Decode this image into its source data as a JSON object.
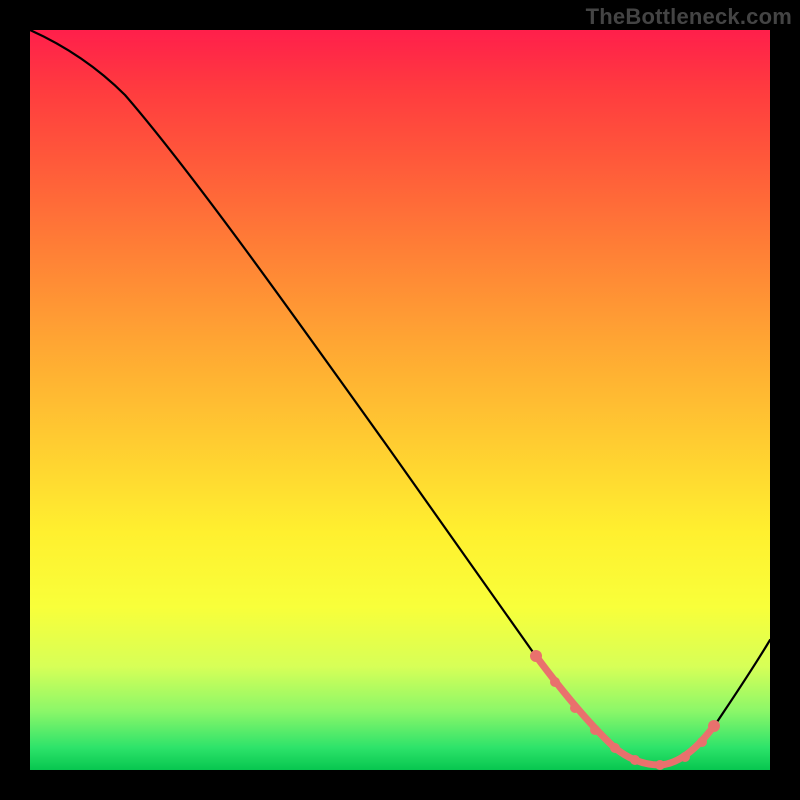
{
  "watermark": "TheBottleneck.com",
  "colors": {
    "background": "#000000",
    "curve": "#000000",
    "highlight": "#e9716d"
  },
  "chart_data": {
    "type": "line",
    "title": "",
    "xlabel": "",
    "ylabel": "",
    "xlim": [
      0,
      100
    ],
    "ylim": [
      0,
      100
    ],
    "grid": false,
    "legend": false,
    "note": "Values estimated from pixel positions; axes are unlabeled in source image.",
    "series": [
      {
        "name": "curve",
        "x": [
          0,
          4,
          8,
          12,
          16,
          20,
          25,
          30,
          35,
          40,
          45,
          50,
          55,
          60,
          65,
          68,
          72,
          75,
          78,
          80,
          82,
          85,
          88,
          91,
          94,
          97,
          100
        ],
        "values": [
          100,
          98,
          96,
          93,
          90,
          86,
          80,
          73,
          66,
          59,
          52,
          45,
          38,
          31,
          23,
          18,
          12,
          8,
          5,
          3,
          1.6,
          0.7,
          0.9,
          3,
          7,
          12,
          18
        ]
      }
    ],
    "highlight_region": {
      "name": "optimal-zone",
      "x_start": 68,
      "x_end": 93,
      "description": "salmon dotted overlay near curve minimum"
    }
  }
}
